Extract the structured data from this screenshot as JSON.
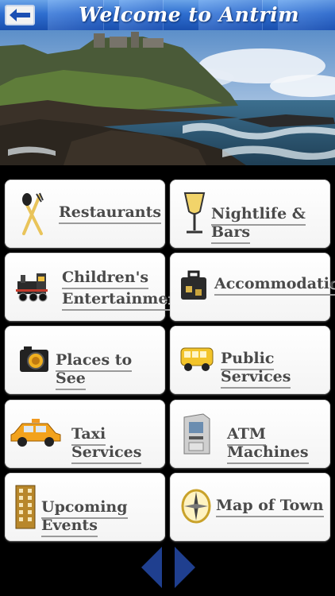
{
  "header": {
    "title": "Welcome to Antrim"
  },
  "menu": [
    {
      "label": "Restaurants",
      "icon": "cutlery-icon"
    },
    {
      "label": "Nightlife & Bars",
      "icon": "cocktail-glass-icon"
    },
    {
      "label_line1": "Children's",
      "label_line2": "Entertainment",
      "icon": "toy-train-icon"
    },
    {
      "label": "Accommodation",
      "icon": "suitcase-icon"
    },
    {
      "label": "Places to See",
      "icon": "camera-icon"
    },
    {
      "label": "Public Services",
      "icon": "bus-icon"
    },
    {
      "label": "Taxi Services",
      "icon": "taxi-icon"
    },
    {
      "label": "ATM Machines",
      "icon": "atm-icon"
    },
    {
      "label": "Upcoming Events",
      "icon": "building-icon"
    },
    {
      "label": "Map of Town",
      "icon": "compass-icon"
    }
  ],
  "colors": {
    "header": "#2f6fd0",
    "arrow": "#1f3f8f"
  }
}
